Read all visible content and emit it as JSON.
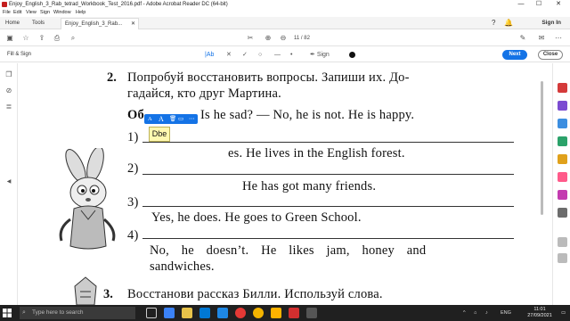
{
  "window": {
    "title": "Enjoy_English_3_Rab_tetrad_Workbook_Test_2016.pdf - Adobe Acrobat Reader DC (64-bit)",
    "minimize": "—",
    "maximize": "☐",
    "close": "✕"
  },
  "menu": [
    "File",
    "Edit",
    "View",
    "Sign",
    "Window",
    "Help"
  ],
  "tabs": {
    "home": "Home",
    "tools": "Tools",
    "document": "Enjoy_English_3_Rab...",
    "sign_in": "Sign In"
  },
  "toolbar": {
    "current_page": "11",
    "total_pages": "/ 82"
  },
  "fill_sign": {
    "label": "Fill & Sign",
    "text_tool": "Ab",
    "sign_label": "Sign",
    "next": "Next",
    "close": "Close"
  },
  "annotation": {
    "textbox_value": "Dbe"
  },
  "document": {
    "task2_number": "2.",
    "task2_line1": "Попробуй восстановить вопросы. Запиши их. До-",
    "task2_line2": "гадайся, кто друг Мартина.",
    "example_prefix": "Об",
    "example_text": "Is he sad? — No, he is not. He is happy.",
    "items": [
      {
        "num": "1)",
        "answer": "es. He lives in the English forest."
      },
      {
        "num": "2)",
        "answer": "He has got many friends."
      },
      {
        "num": "3)",
        "answer": "Yes, he does. He goes to Green School."
      },
      {
        "num": "4)",
        "answer": "No, he doesn’t. He likes jam, honey and"
      }
    ],
    "item4_line2": "sandwiches.",
    "task3_number": "3.",
    "task3_text": "Восстанови рассказ Билли. Используй слова."
  },
  "taskbar": {
    "search_placeholder": "Type here to search",
    "lang": "ENG",
    "time": "11:01",
    "date": "27/09/2021"
  },
  "colors": {
    "accent": "#1473e6",
    "taskbar": "#202020"
  }
}
